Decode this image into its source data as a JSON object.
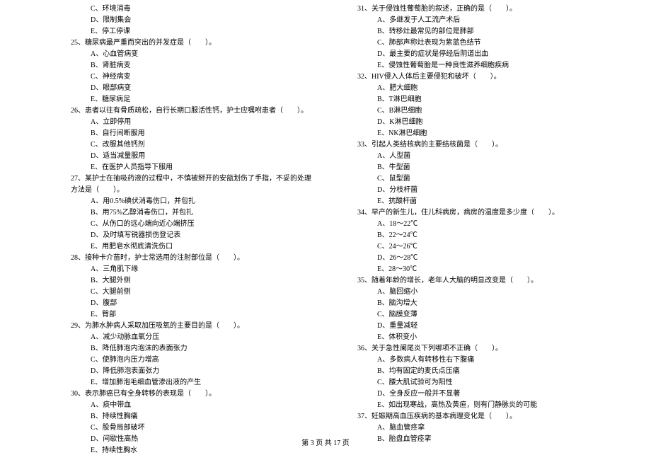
{
  "left": [
    {
      "cls": "opt",
      "t": "C、环境消毒"
    },
    {
      "cls": "opt",
      "t": "D、限制集会"
    },
    {
      "cls": "opt",
      "t": "E、停工停课"
    },
    {
      "cls": "q",
      "t": "25、糖尿病最严重而突出的并发症是（　　）。"
    },
    {
      "cls": "opt",
      "t": "A、心血管病变"
    },
    {
      "cls": "opt",
      "t": "B、肾脏病变"
    },
    {
      "cls": "opt",
      "t": "C、神经病变"
    },
    {
      "cls": "opt",
      "t": "D、眼部病变"
    },
    {
      "cls": "opt",
      "t": "E、糖尿病足"
    },
    {
      "cls": "q",
      "t": "26、患者以往有骨质疏松，自行长期口服活性钙，护士应嘱咐患者（　　）。"
    },
    {
      "cls": "opt",
      "t": "A、立即停用"
    },
    {
      "cls": "opt",
      "t": "B、自行间断服用"
    },
    {
      "cls": "opt",
      "t": "C、改服其他钙剂"
    },
    {
      "cls": "opt",
      "t": "D、适当减量服用"
    },
    {
      "cls": "opt",
      "t": "E、在医护人员指导下服用"
    },
    {
      "cls": "q",
      "t": "27、某护士在抽吸药液的过程中，不慎被掰开的安瓿划伤了手指，不妥的处理方法是（　　）。"
    },
    {
      "cls": "opt",
      "t": "A、用0.5%碘伏消毒伤口，并包扎"
    },
    {
      "cls": "opt",
      "t": "B、用75%乙醇消毒伤口，并包扎"
    },
    {
      "cls": "opt",
      "t": "C、从伤口的远心端向近心端挤压"
    },
    {
      "cls": "opt",
      "t": "D、及时填写锐器损伤登记表"
    },
    {
      "cls": "opt",
      "t": "E、用肥皂水彻底清洗伤口"
    },
    {
      "cls": "q",
      "t": "28、接种卡介苗时，护士常选用的注射部位是（　　）。"
    },
    {
      "cls": "opt",
      "t": "A、三角肌下缘"
    },
    {
      "cls": "opt",
      "t": "B、大腿外侧"
    },
    {
      "cls": "opt",
      "t": "C、大腿前侧"
    },
    {
      "cls": "opt",
      "t": "D、腹部"
    },
    {
      "cls": "opt",
      "t": "E、臀部"
    },
    {
      "cls": "q",
      "t": "29、为肺水肿病人采取加压吸氧的主要目的是（　　）。"
    },
    {
      "cls": "opt",
      "t": "A、减少动脉血氧分压"
    },
    {
      "cls": "opt",
      "t": "B、降低肺泡内泡沫的表面张力"
    },
    {
      "cls": "opt",
      "t": "C、使肺泡内压力增高"
    },
    {
      "cls": "opt",
      "t": "D、降低肺泡表面张力"
    },
    {
      "cls": "opt",
      "t": "E、增加肺泡毛细血管渗出液的产生"
    },
    {
      "cls": "q",
      "t": "30、表示肺癌已有全身转移的表现是（　　）。"
    },
    {
      "cls": "opt",
      "t": "A、痰中带血"
    },
    {
      "cls": "opt",
      "t": "B、持续性胸痛"
    },
    {
      "cls": "opt",
      "t": "C、股骨局部破坏"
    },
    {
      "cls": "opt",
      "t": "D、间歇性高热"
    },
    {
      "cls": "opt",
      "t": "E、持续性胸水"
    }
  ],
  "right": [
    {
      "cls": "q",
      "t": "31、关于侵蚀性葡萄胎的叙述，正确的是（　　）。"
    },
    {
      "cls": "opt",
      "t": "A、多继发于人工流产术后"
    },
    {
      "cls": "opt",
      "t": "B、转移灶最常见的部位是肺部"
    },
    {
      "cls": "opt",
      "t": "C、肺部声称灶表现为紫蓝色结节"
    },
    {
      "cls": "opt",
      "t": "D、最主要的症状是停经后阴道出血"
    },
    {
      "cls": "opt",
      "t": "E、侵蚀性葡萄胎是一种良性滋养细胞疾病"
    },
    {
      "cls": "q",
      "t": "32、HIV侵入人体后主要侵犯和破坏（　　）。"
    },
    {
      "cls": "opt",
      "t": "A、肥大细胞"
    },
    {
      "cls": "opt",
      "t": "B、T淋巴细胞"
    },
    {
      "cls": "opt",
      "t": "C、B淋巴细胞"
    },
    {
      "cls": "opt",
      "t": "D、K淋巴细胞"
    },
    {
      "cls": "opt",
      "t": "E、NK淋巴细胞"
    },
    {
      "cls": "q",
      "t": "33、引起人类结核病的主要结核菌是（　　）。"
    },
    {
      "cls": "opt",
      "t": "A、人型菌"
    },
    {
      "cls": "opt",
      "t": "B、牛型菌"
    },
    {
      "cls": "opt",
      "t": "C、鼠型菌"
    },
    {
      "cls": "opt",
      "t": "D、分枝杆菌"
    },
    {
      "cls": "opt",
      "t": "E、抗酸杆菌"
    },
    {
      "cls": "q",
      "t": "34、早产的新生儿，住儿科病房，病房的温度是多少度（　　）。"
    },
    {
      "cls": "opt",
      "t": "A、18～22℃"
    },
    {
      "cls": "opt",
      "t": "B、22～24℃"
    },
    {
      "cls": "opt",
      "t": "C、24～26℃"
    },
    {
      "cls": "opt",
      "t": "D、26～28℃"
    },
    {
      "cls": "opt",
      "t": "E、28～30℃"
    },
    {
      "cls": "q",
      "t": "35、随着年龄的增长，老年人大脑的明显改变是（　　）。"
    },
    {
      "cls": "opt",
      "t": "A、脑回缩小"
    },
    {
      "cls": "opt",
      "t": "B、脑沟增大"
    },
    {
      "cls": "opt",
      "t": "C、脑膜变薄"
    },
    {
      "cls": "opt",
      "t": "D、重量减轻"
    },
    {
      "cls": "opt",
      "t": "E、体积变小"
    },
    {
      "cls": "q",
      "t": "36、关于急性阑尾炎下列哪项不正确（　　）。"
    },
    {
      "cls": "opt",
      "t": "A、多数病人有转移性右下腹痛"
    },
    {
      "cls": "opt",
      "t": "B、均有固定的麦氏点压痛"
    },
    {
      "cls": "opt",
      "t": "C、腰大肌试验可为阳性"
    },
    {
      "cls": "opt",
      "t": "D、全身反应一般并不显著"
    },
    {
      "cls": "opt",
      "t": "E、如出现寒战，高热及黄疸，则有门静脉炎的可能"
    },
    {
      "cls": "q",
      "t": "37、妊娠期高血压疾病的基本病理变化是（　　）。"
    },
    {
      "cls": "opt",
      "t": "A、脑血管痉挛"
    },
    {
      "cls": "opt",
      "t": "B、胎盘血管痉挛"
    }
  ],
  "footer": "第 3 页 共 17 页"
}
